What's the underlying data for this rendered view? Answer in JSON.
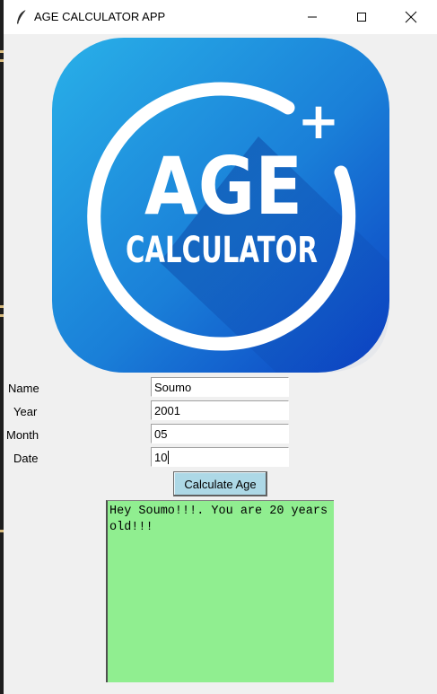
{
  "window": {
    "title": "AGE CALCULATOR APP",
    "minimize_icon": "minimize-icon",
    "maximize_icon": "maximize-icon",
    "close_icon": "close-icon",
    "app_icon": "feather-icon"
  },
  "logo": {
    "line1": "AGE",
    "line2": "CALCULATOR",
    "plus": "+",
    "colors": {
      "top": "#29a8e0",
      "bottom": "#0d47c4"
    }
  },
  "form": {
    "name_label": "Name",
    "name_value": "Soumo",
    "year_label": "Year",
    "year_value": "2001",
    "month_label": "Month",
    "month_value": "05",
    "date_label": "Date",
    "date_value": "10"
  },
  "button": {
    "label": "Calculate Age",
    "color": "#add8e6"
  },
  "output": {
    "text": "Hey Soumo!!!. You are 20 years old!!!",
    "color": "#90ee90"
  }
}
